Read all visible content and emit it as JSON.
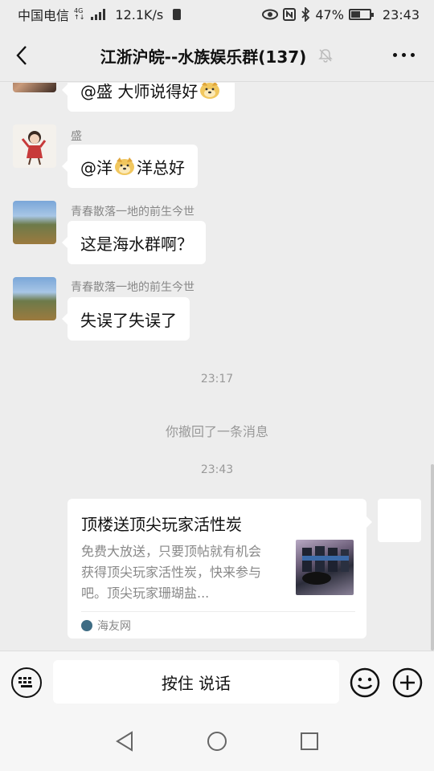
{
  "status_bar": {
    "carrier": "中国电信",
    "network_badge_top": "4G",
    "network_badge_bottom": "↑↓",
    "speed": "12.1K/s",
    "battery_percent": "47%",
    "battery_level": 0.47,
    "time": "23:43"
  },
  "header": {
    "title": "江浙沪皖--水族娱乐群(137)"
  },
  "messages": [
    {
      "sender": "",
      "text_before": "@盛  大师说得好",
      "text_after": "",
      "emoji": "doge"
    },
    {
      "sender": "盛",
      "text_before": "@洋 ",
      "text_after": "洋总好",
      "emoji": "doge"
    },
    {
      "sender": "青春散落一地的前生今世",
      "text_before": "这是海水群啊？",
      "text_after": "",
      "emoji": ""
    },
    {
      "sender": "青春散落一地的前生今世",
      "text_before": "失误了失误了",
      "text_after": "",
      "emoji": ""
    }
  ],
  "timestamps": [
    "23:17",
    "23:43"
  ],
  "system_message": "你撤回了一条消息",
  "shared_card": {
    "title": "顶楼送顶尖玩家活性炭",
    "description": "免费大放送，只要顶帖就有机会获得顶尖玩家活性炭，快来参与吧。顶尖玩家珊瑚盐...",
    "source": "海友网"
  },
  "input_bar": {
    "hold_to_talk": "按住 说话"
  }
}
